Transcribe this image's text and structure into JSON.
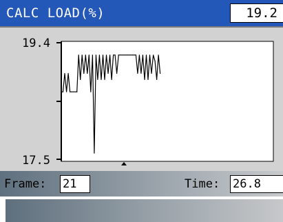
{
  "header": {
    "title": "CALC LOAD(%)",
    "value": "19.2",
    "bar_color": "#2358b8"
  },
  "graph": {
    "y_max_label": "19.4",
    "y_min_label": "17.5",
    "cursor_icon": "up-triangle-icon"
  },
  "chart_data": {
    "type": "line",
    "ylim": [
      17.5,
      19.4
    ],
    "yticks": [
      "19.4",
      "17.5"
    ],
    "series": [
      {
        "values": [
          18.6,
          18.6,
          18.9,
          18.6,
          18.9,
          18.6,
          18.6,
          18.6,
          18.6,
          18.6,
          19.2,
          18.8,
          19.2,
          18.9,
          19.2,
          18.9,
          19.2,
          18.6,
          19.2,
          17.6,
          19.2,
          18.8,
          19.2,
          18.8,
          19.2,
          18.8,
          19.2,
          18.9,
          19.2,
          18.8,
          19.2,
          19.2,
          18.9,
          19.2,
          19.2,
          19.2,
          19.2,
          19.2,
          19.2,
          19.2,
          19.2,
          19.2,
          19.2,
          19.2,
          18.9,
          19.2,
          18.9,
          19.2,
          18.8,
          19.2,
          18.8,
          19.2,
          18.9,
          19.2,
          19.1,
          18.8,
          19.2,
          18.9
        ]
      }
    ]
  },
  "status": {
    "frame_label": "Frame:",
    "frame_value": "21",
    "time_label": "Time:",
    "time_value": "26.8"
  }
}
